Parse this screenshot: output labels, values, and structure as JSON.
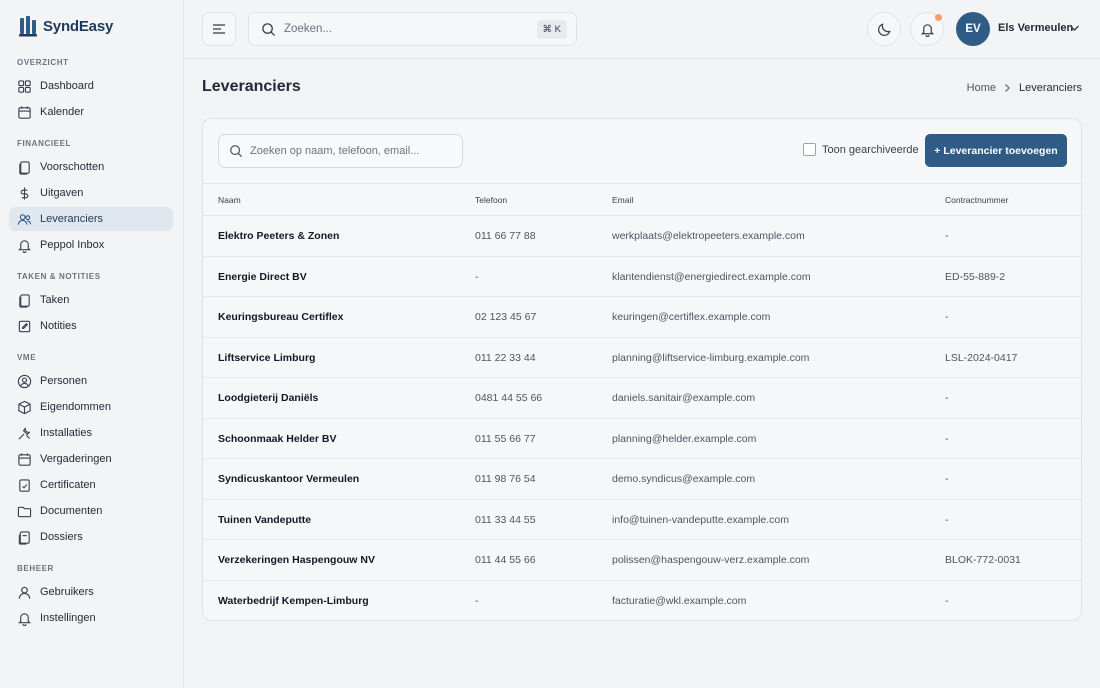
{
  "app": {
    "name": "SyndEasy",
    "brand_color": "#2f5c86"
  },
  "sidebar": {
    "sections": [
      {
        "label": "OVERZICHT"
      },
      {
        "label": "FINANCIEEL"
      },
      {
        "label": "TAKEN & NOTITIES"
      },
      {
        "label": "VME"
      },
      {
        "label": "BEHEER"
      }
    ],
    "items": [
      {
        "label": "Dashboard",
        "icon": "grid-icon"
      },
      {
        "label": "Kalender",
        "icon": "calendar-icon"
      },
      {
        "label": "Voorschotten",
        "icon": "documents-icon"
      },
      {
        "label": "Uitgaven",
        "icon": "dollar-icon"
      },
      {
        "label": "Leveranciers",
        "icon": "users-icon",
        "active": true
      },
      {
        "label": "Peppol Inbox",
        "icon": "bell-icon"
      },
      {
        "label": "Taken",
        "icon": "documents-icon"
      },
      {
        "label": "Notities",
        "icon": "note-icon"
      },
      {
        "label": "Personen",
        "icon": "person-icon"
      },
      {
        "label": "Eigendommen",
        "icon": "box-icon"
      },
      {
        "label": "Installaties",
        "icon": "wrench-icon"
      },
      {
        "label": "Vergaderingen",
        "icon": "calendar-icon"
      },
      {
        "label": "Certificaten",
        "icon": "certificate-icon"
      },
      {
        "label": "Documenten",
        "icon": "folder-icon"
      },
      {
        "label": "Dossiers",
        "icon": "dossier-icon"
      },
      {
        "label": "Gebruikers",
        "icon": "person-icon"
      },
      {
        "label": "Instellingen",
        "icon": "gear-icon"
      }
    ]
  },
  "topbar": {
    "search_placeholder": "Zoeken...",
    "shortcut": "⌘ K",
    "user": {
      "initials": "EV",
      "name": "Els Vermeulen"
    }
  },
  "page": {
    "title": "Leveranciers",
    "breadcrumb": {
      "home": "Home",
      "current": "Leveranciers"
    }
  },
  "toolbar": {
    "search_placeholder": "Zoeken op naam, telefoon, email...",
    "archive_label": "Toon gearchiveerde",
    "archive_checked": false,
    "add_label": "+ Leverancier toevoegen"
  },
  "table": {
    "headers": {
      "name": "Naam",
      "phone": "Telefoon",
      "email": "Email",
      "contract": "Contractnummer"
    },
    "rows": [
      {
        "name": "Elektro Peeters & Zonen",
        "phone": "011 66 77 88",
        "email": "werkplaats@elektropeeters.example.com",
        "contract": "-"
      },
      {
        "name": "Energie Direct BV",
        "phone": "-",
        "email": "klantendienst@energiedirect.example.com",
        "contract": "ED-55-889-2"
      },
      {
        "name": "Keuringsbureau Certiflex",
        "phone": "02 123 45 67",
        "email": "keuringen@certiflex.example.com",
        "contract": "-"
      },
      {
        "name": "Liftservice Limburg",
        "phone": "011 22 33 44",
        "email": "planning@liftservice-limburg.example.com",
        "contract": "LSL-2024-0417"
      },
      {
        "name": "Loodgieterij Daniëls",
        "phone": "0481 44 55 66",
        "email": "daniels.sanitair@example.com",
        "contract": "-"
      },
      {
        "name": "Schoonmaak Helder BV",
        "phone": "011 55 66 77",
        "email": "planning@helder.example.com",
        "contract": "-"
      },
      {
        "name": "Syndicuskantoor Vermeulen",
        "phone": "011 98 76 54",
        "email": "demo.syndicus@example.com",
        "contract": "-"
      },
      {
        "name": "Tuinen Vandeputte",
        "phone": "011 33 44 55",
        "email": "info@tuinen-vandeputte.example.com",
        "contract": "-"
      },
      {
        "name": "Verzekeringen Haspengouw NV",
        "phone": "011 44 55 66",
        "email": "polissen@haspengouw-verz.example.com",
        "contract": "BLOK-772-0031"
      },
      {
        "name": "Waterbedrijf Kempen-Limburg",
        "phone": "-",
        "email": "facturatie@wkl.example.com",
        "contract": "-"
      }
    ]
  }
}
